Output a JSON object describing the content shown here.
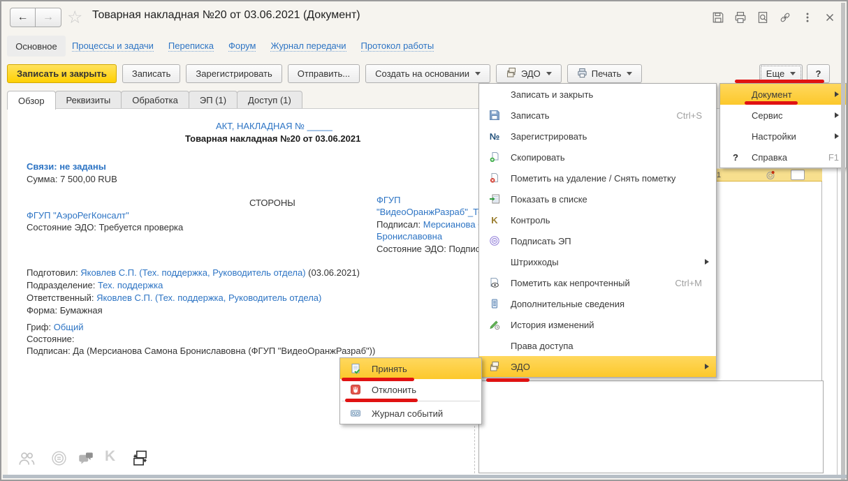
{
  "glyphs": {
    "star": "☆",
    "back": "←",
    "forward": "→",
    "number_icon": "№",
    "control_icon": "K",
    "help": "?"
  },
  "colors": {
    "accent_yellow": "#fcc82b",
    "annotation_red": "#e01212",
    "link_blue": "#2d74c4",
    "toolbar_yellow": "#ffd002"
  },
  "window": {
    "title": "Товарная накладная №20 от 03.06.2021 (Документ)"
  },
  "header_icons": [
    "save-icon",
    "print-icon",
    "preview-icon",
    "link-icon",
    "more-dots-icon",
    "close-icon"
  ],
  "nav": {
    "items": [
      {
        "label": "Основное",
        "active": true
      },
      {
        "label": "Процессы и задачи"
      },
      {
        "label": "Переписка"
      },
      {
        "label": "Форум"
      },
      {
        "label": "Журнал передачи"
      },
      {
        "label": "Протокол работы"
      }
    ]
  },
  "toolbar": {
    "save_close": "Записать и закрыть",
    "save": "Записать",
    "register": "Зарегистрировать",
    "send": "Отправить...",
    "create_based": "Создать на основании",
    "edo": "ЭДО",
    "print": "Печать",
    "more": "Еще",
    "help": "?"
  },
  "tabs": {
    "items": [
      "Обзор",
      "Реквизиты",
      "Обработка",
      "ЭП (1)",
      "Доступ (1)"
    ],
    "active": "Обзор"
  },
  "document": {
    "act_line": "АКТ, НАКЛАДНАЯ № _____",
    "title": "Товарная накладная №20 от 03.06.2021",
    "links_line": "Связи: не заданы",
    "sum_line": "Сумма: 7 500,00 RUB",
    "parties_header": "СТОРОНЫ",
    "party_left": {
      "name": "ФГУП \"АэроРегКонсалт\"",
      "edo_state": "Состояние ЭДО: Требуется проверка"
    },
    "party_right": {
      "line1": "ФГУП",
      "line2": "\"ВидеоОранжРазраб\"_Те",
      "line3_label": "Подписал: ",
      "line3_link": "Мерсианова Са",
      "line4": "Брониславовна",
      "line5": "Состояние ЭДО: Подпис"
    },
    "prepared_label": "Подготовил: ",
    "prepared_link": "Яковлев С.П. (Тех. поддержка, Руководитель отдела)",
    "prepared_date": " (03.06.2021)",
    "department_label": "Подразделение: ",
    "department_link": "Тех. поддержка",
    "responsible_label": "Ответственный: ",
    "responsible_link": "Яковлев С.П. (Тех. поддержка, Руководитель отдела)",
    "form_line": "Форма: Бумажная",
    "grif_label": "Гриф: ",
    "grif_link": "Общий",
    "state_line": "Состояние:",
    "signed_line": "Подписан: Да (Мерсианова Самона Брониславовна (ФГУП \"ВидеоОранжРазраб\"))"
  },
  "menus": {
    "document_menu": {
      "items": [
        {
          "label": "Записать и закрыть"
        },
        {
          "label": "Записать",
          "shortcut": "Ctrl+S",
          "icon": "save-icon"
        },
        {
          "label": "Зарегистрировать",
          "icon": "number-icon"
        },
        {
          "label": "Скопировать",
          "icon": "copy-icon"
        },
        {
          "label": "Пометить на удаление / Снять пометку",
          "icon": "delete-mark-icon"
        },
        {
          "label": "Показать в списке",
          "icon": "show-in-list-icon"
        },
        {
          "label": "Контроль",
          "icon": "control-icon"
        },
        {
          "label": "Подписать ЭП",
          "icon": "sign-ep-icon"
        },
        {
          "label": "Штрихкоды",
          "submenu": true
        },
        {
          "label": "Пометить как непрочтенный",
          "shortcut": "Ctrl+M",
          "icon": "unread-icon"
        },
        {
          "label": "Дополнительные сведения",
          "icon": "additional-info-icon"
        },
        {
          "label": "История изменений",
          "icon": "history-icon"
        },
        {
          "label": "Права доступа"
        },
        {
          "label": "ЭДО",
          "icon": "edo-exchange-icon",
          "submenu": true,
          "highlighted": true
        }
      ]
    },
    "more_menu": {
      "items": [
        {
          "label": "Документ",
          "submenu": true,
          "highlighted": true
        },
        {
          "label": "Сервис",
          "submenu": true
        },
        {
          "label": "Настройки",
          "submenu": true
        },
        {
          "label": "Справка",
          "shortcut": "F1",
          "icon": "help-icon"
        }
      ]
    },
    "edo_menu": {
      "items": [
        {
          "label": "Принять",
          "icon": "accept-icon",
          "highlighted": true
        },
        {
          "label": "Отклонить",
          "icon": "decline-icon"
        },
        {
          "label": "Журнал событий",
          "icon": "event-log-icon"
        }
      ]
    }
  },
  "side_panel": {
    "header_text": "1"
  },
  "footer_icons": [
    "people-icon",
    "stamp-icon",
    "chat-icon",
    "control-icon",
    "edo-exchange-icon"
  ]
}
